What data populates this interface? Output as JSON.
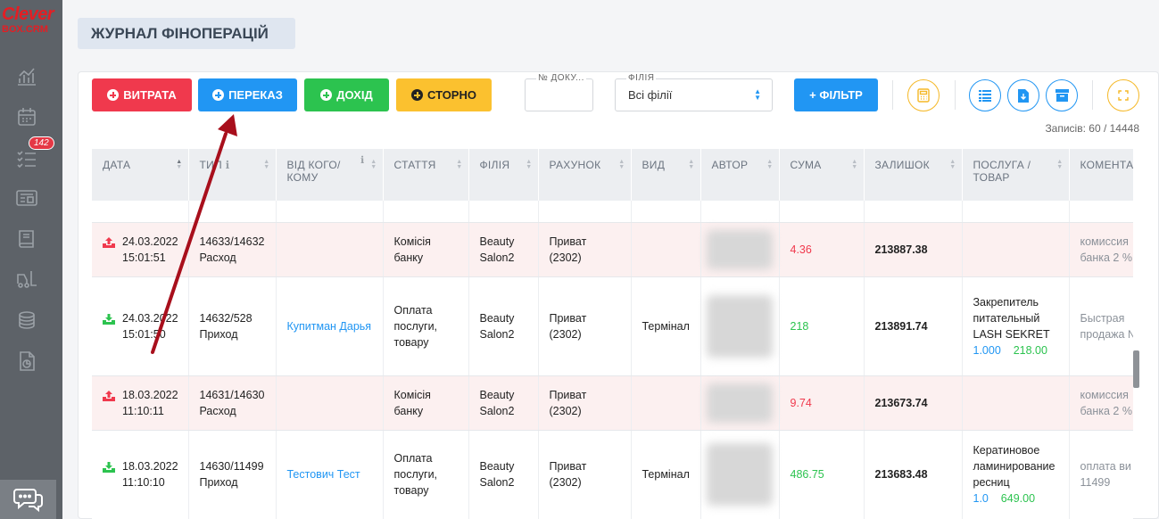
{
  "brand": {
    "line1": "Clever",
    "line2": "BOX.CRM"
  },
  "sidebar": {
    "items": [
      {
        "icon": "analytics-chart-icon"
      },
      {
        "icon": "calendar-icon"
      },
      {
        "icon": "task-list-icon",
        "badge": "142"
      },
      {
        "icon": "id-card-icon"
      },
      {
        "icon": "book-icon"
      },
      {
        "icon": "forklift-icon"
      },
      {
        "icon": "coins-stack-icon"
      },
      {
        "icon": "document-chart-icon"
      }
    ],
    "chat_icon": "chat-bubbles-icon"
  },
  "header": {
    "title": "ЖУРНАЛ ФІНОПЕРАЦІЙ"
  },
  "toolbar": {
    "expense_label": "ВИТРАТА",
    "transfer_label": "ПЕРЕКАЗ",
    "income_label": "ДОХІД",
    "storno_label": "СТОРНО",
    "doc_number_label": "№ ДОКУ...",
    "branch_label": "ФІЛІЯ",
    "branch_value": "Всі філії",
    "filter_label": "+ ФІЛЬТР",
    "icons": [
      "calculator-icon",
      "list-view-icon",
      "download-file-icon",
      "archive-icon",
      "fullscreen-icon"
    ]
  },
  "records": "Записів: 60 / 14448",
  "colors": {
    "red": "#f0394d",
    "blue": "#2196f3",
    "green": "#2cc34f",
    "yellow": "#fbc12f",
    "sidebar": "#5d6268"
  },
  "table": {
    "columns": [
      "ДАТА",
      "ТИП",
      "ВІД КОГО/КОМУ",
      "СТАТТЯ",
      "ФІЛІЯ",
      "РАХУНОК",
      "ВИД",
      "АВТОР",
      "СУМА",
      "ЗАЛИШОК",
      "ПОСЛУГА / ТОВАР",
      "КОМЕНТАР"
    ],
    "rows": [
      {
        "kind": "expense",
        "date": "24.03.2022",
        "time": "15:01:51",
        "type_id": "14633/14632",
        "type": "Расход",
        "party": "",
        "article1": "Комісія",
        "article2": "банку",
        "branch1": "Beauty",
        "branch2": "Salon2",
        "account1": "Приват",
        "account2": "(2302)",
        "method": "",
        "amount": "4.36",
        "balance": "213887.38",
        "service1": "",
        "service2": "",
        "service3": "",
        "qty": "",
        "price": "",
        "comment1": "комиссия",
        "comment2": "банка 2 %"
      },
      {
        "kind": "income",
        "date": "24.03.2022",
        "time": "15:01:50",
        "type_id": "14632/528",
        "type": "Приход",
        "party": "Купитман Дарья",
        "article1": "Оплата",
        "article2": "послуги,",
        "article3": "товару",
        "branch1": "Beauty",
        "branch2": "Salon2",
        "account1": "Приват",
        "account2": "(2302)",
        "method": "Термінал",
        "amount": "218",
        "balance": "213891.74",
        "service1": "Закрепитель",
        "service2": "питательный",
        "service3": "LASH SEKRET",
        "qty": "1.000",
        "price": "218.00",
        "comment1": "Быстрая",
        "comment2": "продажа №"
      },
      {
        "kind": "expense",
        "date": "18.03.2022",
        "time": "11:10:11",
        "type_id": "14631/14630",
        "type": "Расход",
        "party": "",
        "article1": "Комісія",
        "article2": "банку",
        "branch1": "Beauty",
        "branch2": "Salon2",
        "account1": "Приват",
        "account2": "(2302)",
        "method": "",
        "amount": "9.74",
        "balance": "213673.74",
        "service1": "",
        "service2": "",
        "service3": "",
        "qty": "",
        "price": "",
        "comment1": "комиссия",
        "comment2": "банка 2 %"
      },
      {
        "kind": "income",
        "date": "18.03.2022",
        "time": "11:10:10",
        "type_id": "14630/11499",
        "type": "Приход",
        "party": "Тестович Тест",
        "article1": "Оплата",
        "article2": "послуги,",
        "article3": "товару",
        "branch1": "Beauty",
        "branch2": "Salon2",
        "account1": "Приват",
        "account2": "(2302)",
        "method": "Термінал",
        "amount": "486.75",
        "balance": "213683.48",
        "service1": "Кератиновое",
        "service2": "ламинирование",
        "service3": "ресниц",
        "qty": "1.0",
        "price": "649.00",
        "comment1": "оплата ви",
        "comment2": "11499"
      }
    ]
  }
}
